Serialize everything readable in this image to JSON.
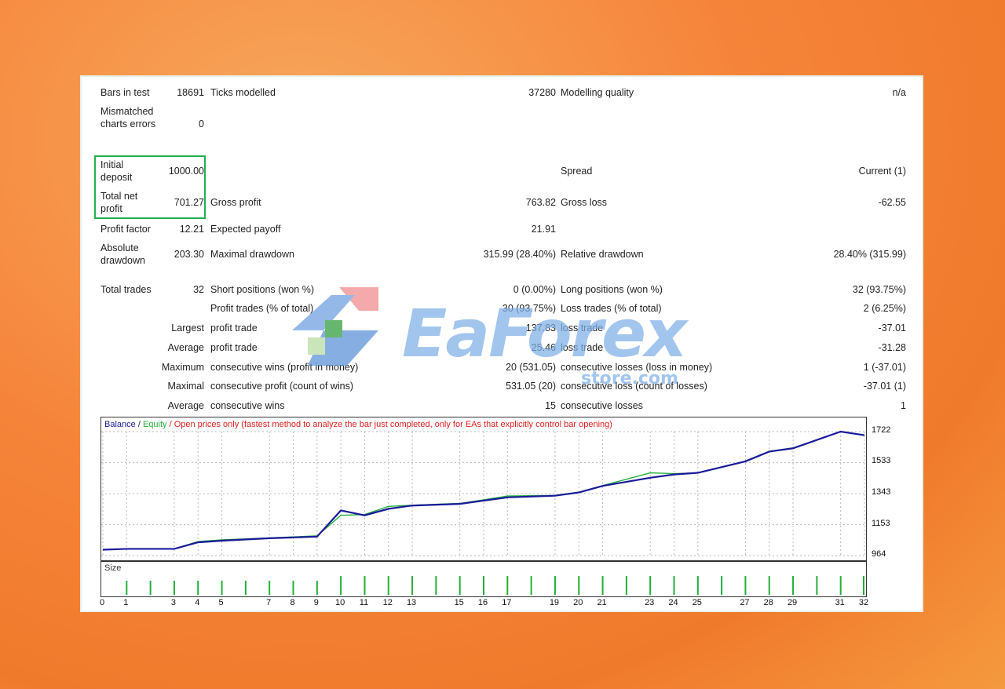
{
  "report": {
    "rows": [
      {
        "label": "Bars in test",
        "value": "18691",
        "label2": "Ticks modelled",
        "value2": "37280",
        "label3": "Modelling quality",
        "value3": "n/a"
      },
      {
        "label": "Mismatched charts errors",
        "value": "0"
      },
      {
        "label": "Initial deposit",
        "value": "1000.00",
        "label3": "Spread",
        "value3": "Current (1)"
      },
      {
        "label": "Total net profit",
        "value": "701.27",
        "label2": "Gross profit",
        "value2": "763.82",
        "label3": "Gross loss",
        "value3": "-62.55"
      },
      {
        "label": "Profit factor",
        "value": "12.21",
        "label2": "Expected payoff",
        "value2": "21.91"
      },
      {
        "label": "Absolute drawdown",
        "value": "203.30",
        "label2": "Maximal drawdown",
        "value2": "315.99 (28.40%)",
        "label3": "Relative drawdown",
        "value3": "28.40% (315.99)"
      },
      {
        "label": "Total trades",
        "value": "32",
        "label2": "Short positions (won %)",
        "value2": "0 (0.00%)",
        "label3": "Long positions (won %)",
        "value3": "32 (93.75%)"
      },
      {
        "label2": "Profit trades (% of total)",
        "value2": "30 (93.75%)",
        "label3": "Loss trades (% of total)",
        "value3": "2 (6.25%)"
      },
      {
        "value": "Largest",
        "label2": "profit trade",
        "value2": "137.83",
        "label3": "loss trade",
        "value3": "-37.01"
      },
      {
        "value": "Average",
        "label2": "profit trade",
        "value2": "25.46",
        "label3": "loss trade",
        "value3": "-31.28"
      },
      {
        "value": "Maximum",
        "label2": "consecutive wins (profit in money)",
        "value2": "20 (531.05)",
        "label3": "consecutive losses (loss in money)",
        "value3": "1 (-37.01)"
      },
      {
        "value": "Maximal",
        "label2": "consecutive profit (count of wins)",
        "value2": "531.05 (20)",
        "label3": "consecutive loss (count of losses)",
        "value3": "-37.01 (1)"
      },
      {
        "value": "Average",
        "label2": "consecutive wins",
        "value2": "15",
        "label3": "consecutive losses",
        "value3": "1"
      }
    ]
  },
  "watermark": {
    "brand": "EaForex",
    "sub": "store.com"
  },
  "chart": {
    "legend_balance": "Balance",
    "legend_sep1": " / ",
    "legend_equity": "Equity",
    "legend_sep2": " / ",
    "legend_note": "Open prices only (fastest method to analyze the bar just completed, only for EAs that explicitly control bar opening)",
    "size_label": "Size",
    "colors": {
      "balance": "#1a1a9a",
      "equity": "#23b03a",
      "grid": "#b8b8b8",
      "size_bar": "#23b03a"
    }
  },
  "chart_data": {
    "type": "line",
    "y_ticks": [
      "1722",
      "1533",
      "1343",
      "1153",
      "964"
    ],
    "ylim": [
      964,
      1722
    ],
    "x_ticks": [
      "0",
      "1",
      "3",
      "4",
      "5",
      "7",
      "8",
      "9",
      "10",
      "11",
      "12",
      "13",
      "15",
      "16",
      "17",
      "19",
      "20",
      "21",
      "23",
      "24",
      "25",
      "27",
      "28",
      "29",
      "31",
      "32"
    ],
    "xlim": [
      0,
      32
    ],
    "series": [
      {
        "name": "Balance",
        "x": [
          0,
          1,
          3,
          4,
          5,
          7,
          8,
          9,
          10,
          11,
          12,
          13,
          15,
          16,
          17,
          19,
          20,
          21,
          23,
          24,
          25,
          27,
          28,
          29,
          31,
          32
        ],
        "values": [
          1000,
          1005,
          1005,
          1045,
          1055,
          1070,
          1075,
          1080,
          1240,
          1210,
          1250,
          1270,
          1280,
          1300,
          1320,
          1330,
          1350,
          1390,
          1440,
          1460,
          1470,
          1540,
          1600,
          1620,
          1722,
          1700
        ]
      },
      {
        "name": "Equity",
        "x": [
          0,
          1,
          3,
          4,
          5,
          7,
          8,
          9,
          10,
          11,
          12,
          13,
          15,
          16,
          17,
          19,
          20,
          21,
          23,
          24,
          25,
          27,
          28,
          29,
          31,
          32
        ],
        "values": [
          1000,
          1005,
          1005,
          1050,
          1060,
          1072,
          1078,
          1085,
          1210,
          1215,
          1265,
          1272,
          1283,
          1305,
          1328,
          1332,
          1352,
          1392,
          1470,
          1465,
          1470,
          1542,
          1602,
          1622,
          1722,
          1700
        ]
      }
    ],
    "size_values": [
      1,
      1,
      1,
      1,
      1,
      1,
      1,
      1,
      1,
      1,
      1,
      1,
      1,
      1,
      1,
      1,
      1,
      1,
      1,
      1,
      1,
      1,
      1,
      1,
      1,
      1,
      1,
      1,
      1,
      1,
      1,
      1
    ]
  }
}
